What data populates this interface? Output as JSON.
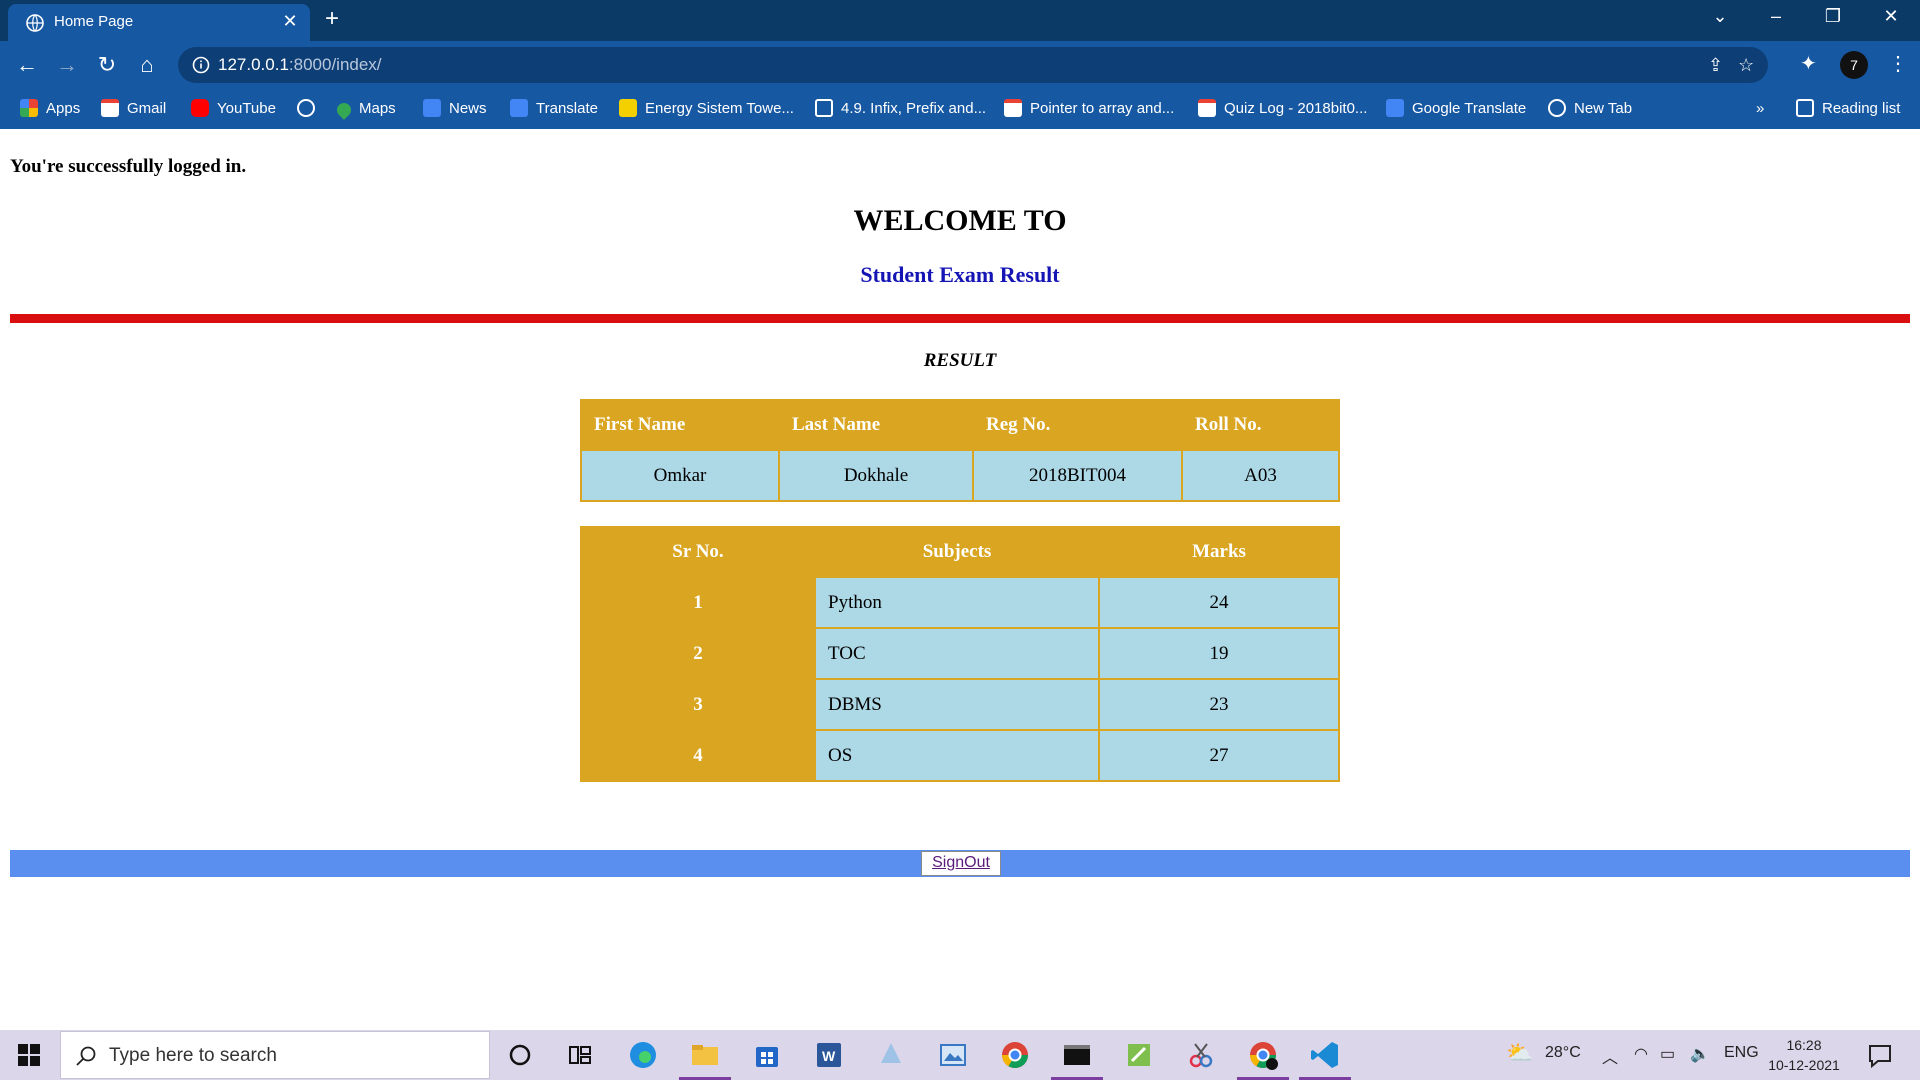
{
  "browser": {
    "tab_title": "Home Page",
    "url_host": "127.0.0.1",
    "url_rest": ":8000/index/",
    "profile_initial": "7",
    "bookmarks": [
      {
        "label": "Apps",
        "icon": "apps-grid-icon",
        "color": "#e8453c"
      },
      {
        "label": "Gmail",
        "icon": "gmail-icon",
        "color": "#ea4335"
      },
      {
        "label": "YouTube",
        "icon": "youtube-icon",
        "color": "#ff0000"
      },
      {
        "label": "",
        "icon": "globe-icon",
        "color": "#ffffff"
      },
      {
        "label": "Maps",
        "icon": "maps-icon",
        "color": "#34a853"
      },
      {
        "label": "News",
        "icon": "news-icon",
        "color": "#4285f4"
      },
      {
        "label": "Translate",
        "icon": "translate-icon",
        "color": "#4285f4"
      },
      {
        "label": "Energy Sistem Towe...",
        "icon": "energy-icon",
        "color": "#f4d000"
      },
      {
        "label": "4.9. Infix, Prefix and...",
        "icon": "book-icon",
        "color": "#ffffff"
      },
      {
        "label": "Pointer to array and...",
        "icon": "gmail-icon",
        "color": "#ea4335"
      },
      {
        "label": "Quiz Log - 2018bit0...",
        "icon": "gmail-icon",
        "color": "#ea4335"
      },
      {
        "label": "Google Translate",
        "icon": "translate-icon",
        "color": "#4285f4"
      },
      {
        "label": "New Tab",
        "icon": "globe-icon",
        "color": "#ffffff"
      }
    ],
    "overflow_label": "»",
    "reading_list": "Reading list"
  },
  "page": {
    "login_message": "You're successfully logged in.",
    "welcome": "WELCOME TO",
    "subtitle": "Student Exam Result",
    "result_heading": "RESULT",
    "student_table": {
      "headers": [
        "First Name",
        "Last Name",
        "Reg No.",
        "Roll No."
      ],
      "row": [
        "Omkar",
        "Dokhale",
        "2018BIT004",
        "A03"
      ]
    },
    "marks_table": {
      "headers": [
        "Sr No.",
        "Subjects",
        "Marks"
      ],
      "rows": [
        {
          "sr": "1",
          "subject": "Python",
          "marks": "24"
        },
        {
          "sr": "2",
          "subject": "TOC",
          "marks": "19"
        },
        {
          "sr": "3",
          "subject": "DBMS",
          "marks": "23"
        },
        {
          "sr": "4",
          "subject": "OS",
          "marks": "27"
        }
      ]
    },
    "signout_label": "SignOut",
    "colors": {
      "accent_red": "#d90f0f",
      "table_gold": "#daa520",
      "cell_blue": "#add8e6",
      "footer_blue": "#5b8fef",
      "subtitle_blue": "#1515b5"
    }
  },
  "taskbar": {
    "search_placeholder": "Type here to search",
    "apps": [
      "cortana-icon",
      "task-view-icon",
      "edge-icon",
      "file-explorer-icon",
      "store-icon",
      "word-icon",
      "app-icon",
      "photos-icon",
      "chrome-icon",
      "terminal-icon",
      "app-icon",
      "snip-icon",
      "chrome-profile-icon",
      "vscode-icon"
    ],
    "weather": "28°C",
    "language": "ENG",
    "time": "16:28",
    "date": "10-12-2021"
  }
}
